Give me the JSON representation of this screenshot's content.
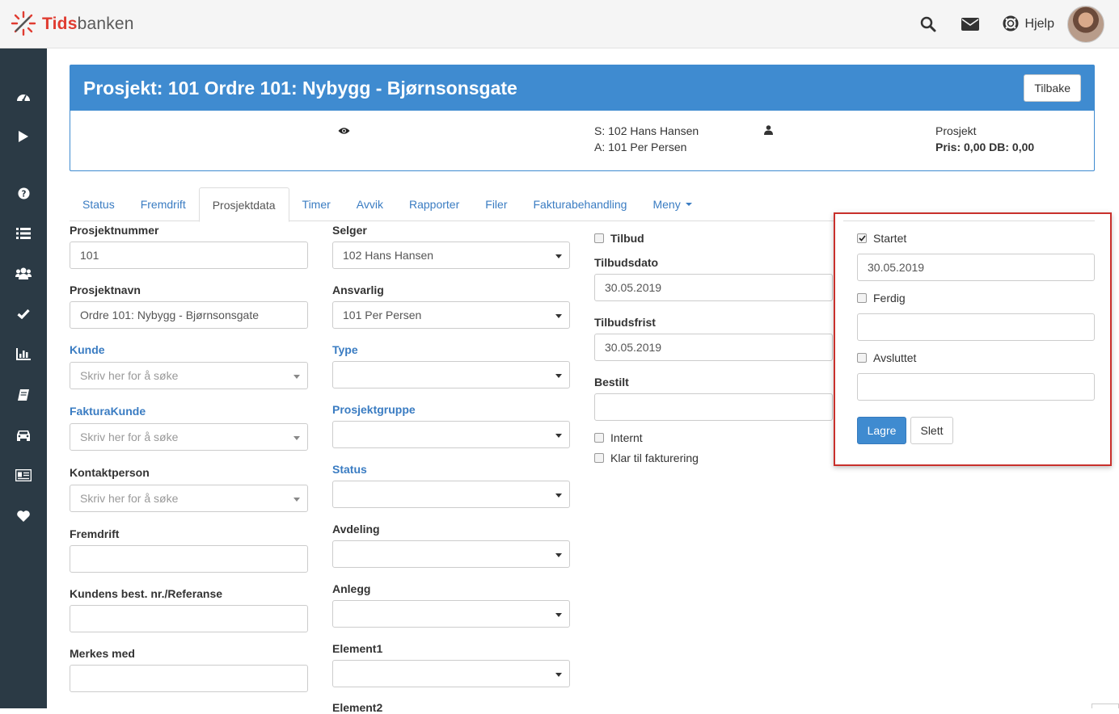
{
  "brand": {
    "part1": "Tids",
    "part2": "banken",
    "accent": "#e03c31"
  },
  "topbar": {
    "help_label": "Hjelp",
    "icons": [
      "search-icon",
      "envelope-icon",
      "lifebuoy-icon"
    ]
  },
  "sidebar": {
    "icons": [
      "dashboard-icon",
      "play-icon",
      "question-icon",
      "list-icon",
      "users-icon",
      "check-icon",
      "bar-chart-icon",
      "book-icon",
      "car-icon",
      "id-card-icon",
      "heart-icon"
    ],
    "bg": "#2b3a45"
  },
  "project": {
    "title": "Prosjekt: 101 Ordre 101: Nybygg - Bjørnsonsgate",
    "back_label": "Tilbake",
    "seller": "S: 102 Hans Hansen",
    "responsible": "A: 101 Per Persen",
    "type_label": "Prosjekt",
    "price": "Pris: 0,00 DB: 0,00",
    "header_color": "#3f8bd0"
  },
  "tabs": [
    {
      "label": "Status"
    },
    {
      "label": "Fremdrift"
    },
    {
      "label": "Prosjektdata",
      "active": true
    },
    {
      "label": "Timer"
    },
    {
      "label": "Avvik"
    },
    {
      "label": "Rapporter"
    },
    {
      "label": "Filer"
    },
    {
      "label": "Fakturabehandling"
    },
    {
      "label": "Meny"
    }
  ],
  "col1": {
    "prosjektnummer": {
      "label": "Prosjektnummer",
      "value": "101"
    },
    "prosjektnavn": {
      "label": "Prosjektnavn",
      "value": "Ordre 101: Nybygg - Bjørnsonsgate"
    },
    "kunde": {
      "label": "Kunde",
      "placeholder": "Skriv her for å søke"
    },
    "fakturakunde": {
      "label": "FakturaKunde",
      "placeholder": "Skriv her for å søke"
    },
    "kontaktperson": {
      "label": "Kontaktperson",
      "placeholder": "Skriv her for å søke"
    },
    "fremdrift": {
      "label": "Fremdrift",
      "value": ""
    },
    "referanse": {
      "label": "Kundens best. nr./Referanse",
      "value": ""
    },
    "merkes": {
      "label": "Merkes med",
      "value": ""
    }
  },
  "col2": {
    "selger": {
      "label": "Selger",
      "value": "102 Hans Hansen"
    },
    "ansvarlig": {
      "label": "Ansvarlig",
      "value": "101 Per Persen"
    },
    "type": {
      "label": "Type",
      "value": ""
    },
    "prosjektgruppe": {
      "label": "Prosjektgruppe",
      "value": ""
    },
    "status": {
      "label": "Status",
      "value": ""
    },
    "avdeling": {
      "label": "Avdeling",
      "value": ""
    },
    "anlegg": {
      "label": "Anlegg",
      "value": ""
    },
    "element1": {
      "label": "Element1",
      "value": ""
    },
    "element2": {
      "label": "Element2"
    }
  },
  "col3": {
    "tilbud": {
      "label": "Tilbud",
      "checked": false
    },
    "tilbudsdato": {
      "label": "Tilbudsdato",
      "value": "30.05.2019"
    },
    "tilbudsfrist": {
      "label": "Tilbudsfrist",
      "value": "30.05.2019"
    },
    "bestilt": {
      "label": "Bestilt",
      "value": ""
    },
    "internt": {
      "label": "Internt",
      "checked": false
    },
    "klar": {
      "label": "Klar til fakturering",
      "checked": false
    }
  },
  "status_panel": {
    "startet": {
      "label": "Startet",
      "checked": true,
      "date": "30.05.2019"
    },
    "ferdig": {
      "label": "Ferdig",
      "checked": false,
      "date": ""
    },
    "avsluttet": {
      "label": "Avsluttet",
      "checked": false,
      "date": ""
    },
    "save_label": "Lagre",
    "delete_label": "Slett",
    "highlight_color": "#c9302c"
  }
}
